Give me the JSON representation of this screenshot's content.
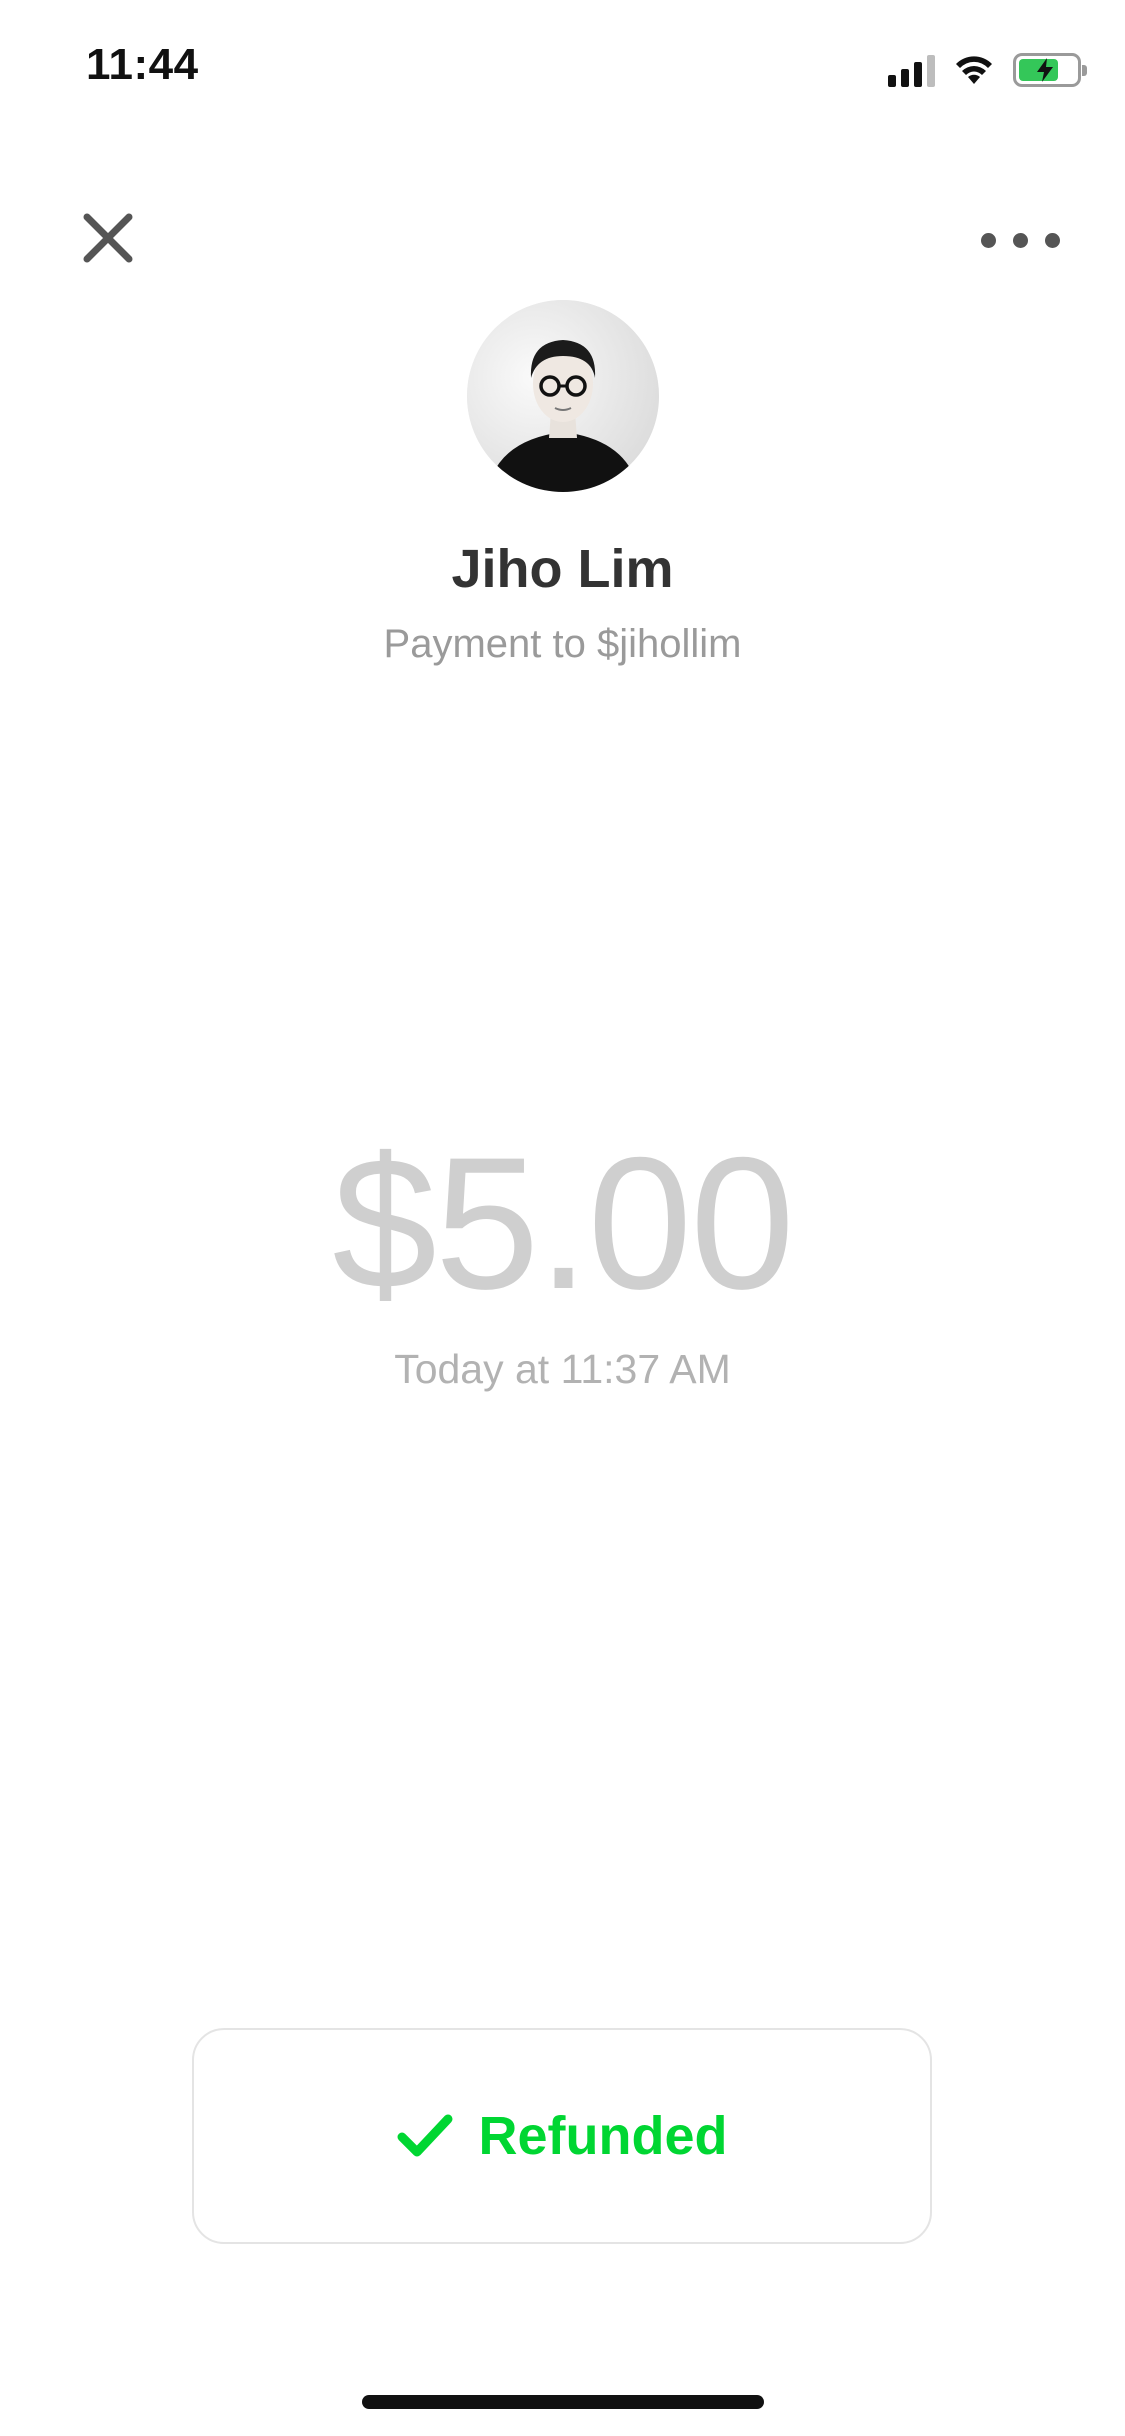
{
  "status_bar": {
    "time": "11:44"
  },
  "recipient": {
    "name": "Jiho Lim",
    "subtitle": "Payment to $jihollim"
  },
  "payment": {
    "amount": "$5.00",
    "timestamp": "Today at 11:37 AM"
  },
  "status_button": {
    "label": "Refunded",
    "color": "#00d632"
  },
  "icons": {
    "close": "close-icon",
    "more": "more-options-icon",
    "check": "checkmark-icon"
  }
}
